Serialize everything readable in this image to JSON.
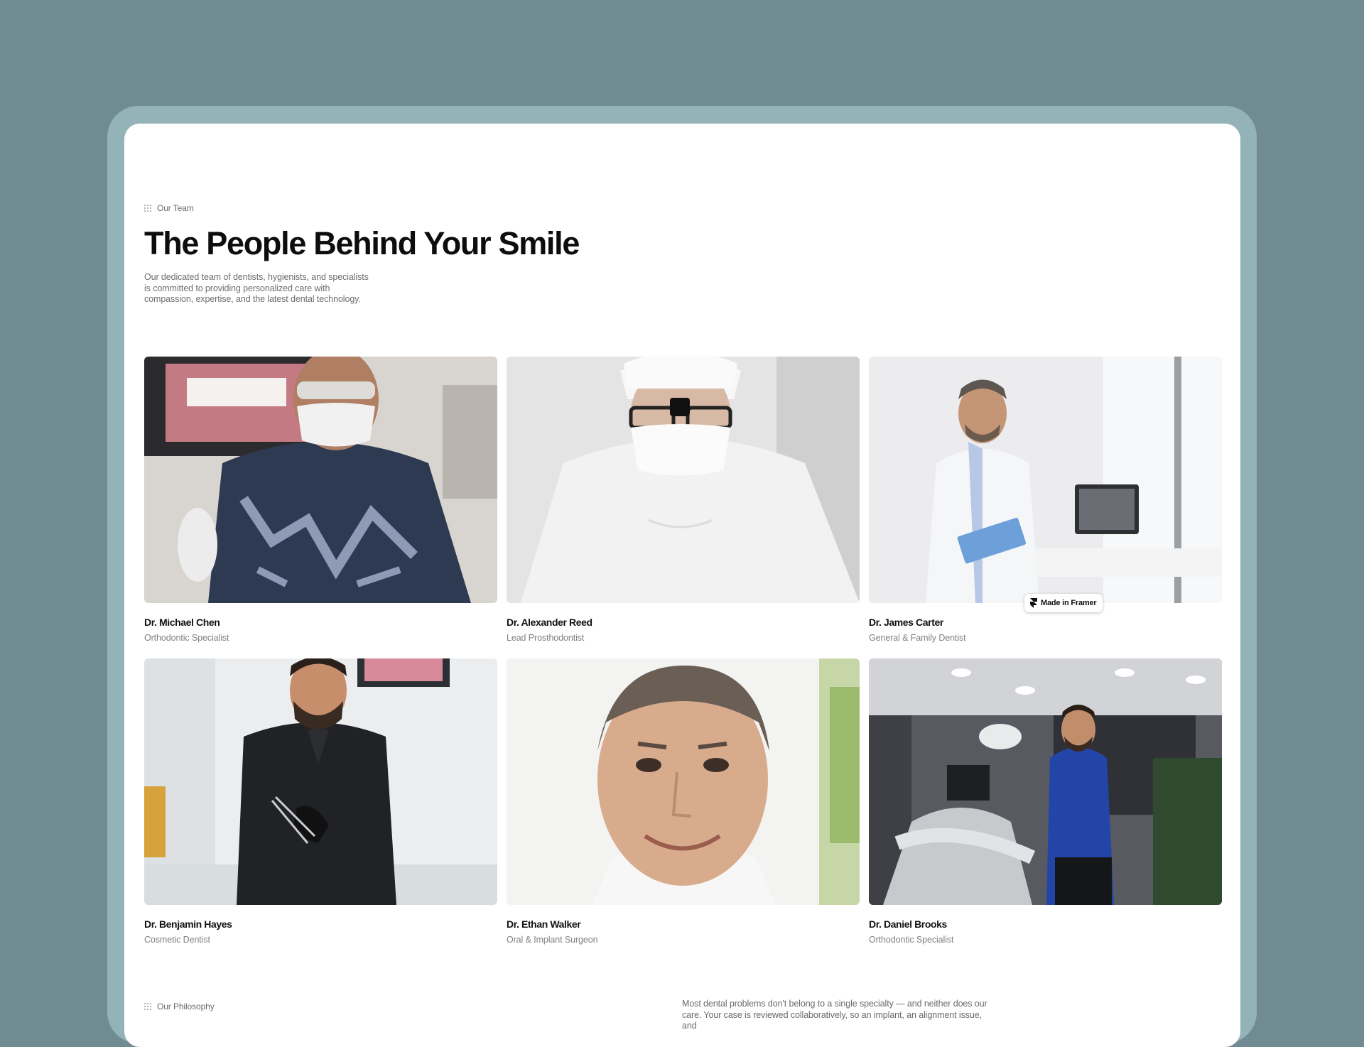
{
  "team_section": {
    "eyebrow": "Our Team",
    "title": "The People Behind Your Smile",
    "intro": "Our dedicated team of dentists, hygienists, and specialists is committed to providing personalized care with compassion, expertise, and the latest dental technology."
  },
  "members": [
    {
      "name": "Dr. Michael Chen",
      "role": "Orthodontic Specialist"
    },
    {
      "name": "Dr. Alexander Reed",
      "role": "Lead Prosthodontist"
    },
    {
      "name": "Dr. James Carter",
      "role": "General & Family Dentist"
    },
    {
      "name": "Dr. Benjamin Hayes",
      "role": "Cosmetic Dentist"
    },
    {
      "name": "Dr. Ethan Walker",
      "role": "Oral & Implant Surgeon"
    },
    {
      "name": "Dr. Daniel Brooks",
      "role": "Orthodontic Specialist"
    }
  ],
  "badge": {
    "label": "Made in Framer",
    "icon": "framer-logo-icon"
  },
  "philosophy_section": {
    "eyebrow": "Our Philosophy",
    "text": "Most dental problems don't belong to a single specialty — and neither does our care. Your case is reviewed collaboratively, so an implant, an alignment issue, and"
  },
  "colors": {
    "backdrop": "#718b92",
    "device_frame": "#93b3b9",
    "page": "#ffffff",
    "heading": "#0d0d0d",
    "muted_text": "#6e6e6e"
  }
}
